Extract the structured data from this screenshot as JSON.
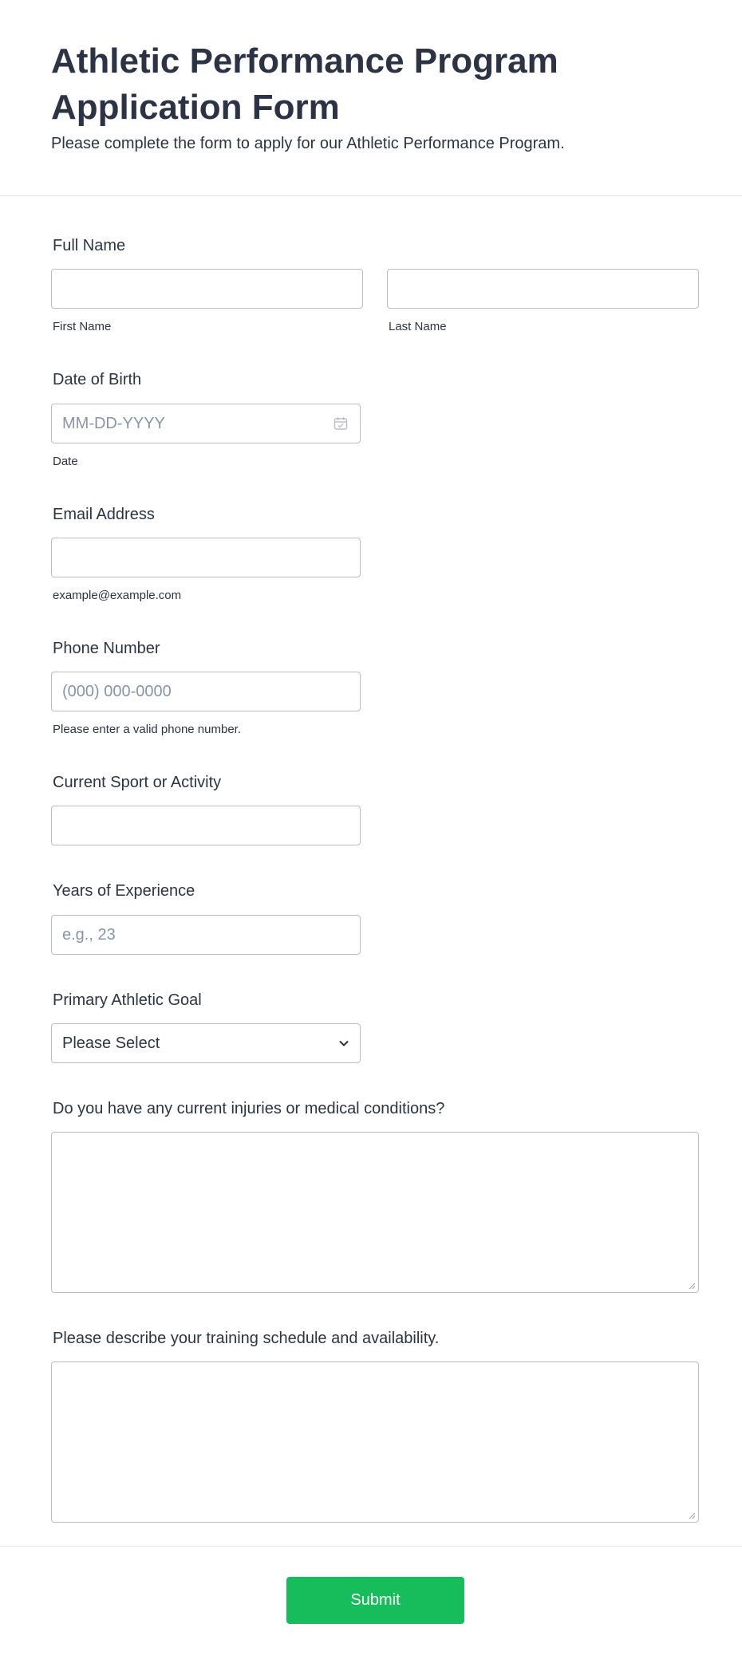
{
  "header": {
    "title": "Athletic Performance Program Application Form",
    "subtitle": "Please complete the form to apply for our Athletic Performance Program."
  },
  "fields": {
    "full_name": {
      "label": "Full Name",
      "first_sublabel": "First Name",
      "last_sublabel": "Last Name"
    },
    "dob": {
      "label": "Date of Birth",
      "placeholder": "MM-DD-YYYY",
      "sublabel": "Date",
      "icon": "calendar-icon"
    },
    "email": {
      "label": "Email Address",
      "sublabel": "example@example.com"
    },
    "phone": {
      "label": "Phone Number",
      "placeholder": "(000) 000-0000",
      "sublabel": "Please enter a valid phone number."
    },
    "sport": {
      "label": "Current Sport or Activity"
    },
    "experience": {
      "label": "Years of Experience",
      "placeholder": "e.g., 23"
    },
    "goal": {
      "label": "Primary Athletic Goal",
      "selected": "Please Select",
      "icon": "chevron-down-icon"
    },
    "injuries": {
      "label": "Do you have any current injuries or medical conditions?"
    },
    "schedule": {
      "label": "Please describe your training schedule and availability."
    }
  },
  "footer": {
    "submit_label": "Submit",
    "submit_color": "#18bd5b"
  }
}
